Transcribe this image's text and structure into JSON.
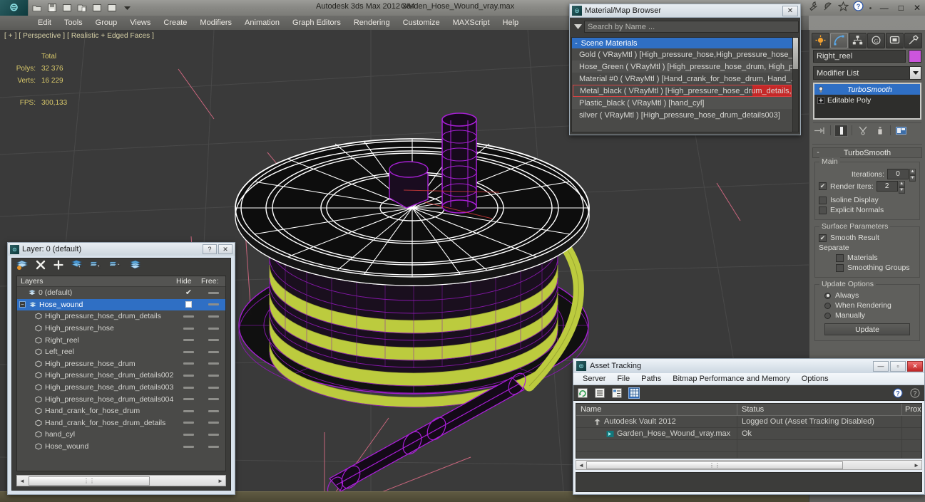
{
  "titlebar": {
    "app_title": "Autodesk 3ds Max  2012 x64",
    "file_title": "Garden_Hose_Wound_vray.max",
    "quick_access": [
      "open-icon",
      "save-icon",
      "undo-icon",
      "redo-icon",
      "page-icon",
      "page2-icon",
      "dropdown-icon"
    ],
    "right_icons": [
      "wrench-icon",
      "satellite-icon",
      "star-icon",
      "help-icon",
      "dot-icon"
    ],
    "window_controls": {
      "minimize": "—",
      "maximize": "□",
      "close": "✕"
    }
  },
  "menubar": {
    "items": [
      "Edit",
      "Tools",
      "Group",
      "Views",
      "Create",
      "Modifiers",
      "Animation",
      "Graph Editors",
      "Rendering",
      "Customize",
      "MAXScript",
      "Help"
    ]
  },
  "viewport": {
    "label": "[ + ] [ Perspective ] [ Realistic + Edged Faces ]",
    "stats": {
      "total_header": "Total",
      "polys_label": "Polys:",
      "polys_value": "32 376",
      "verts_label": "Verts:",
      "verts_value": "16 229",
      "fps_label": "FPS:",
      "fps_value": "300,133"
    },
    "colors": {
      "background": "#3a3a3a",
      "selected_wire": "#ffffff",
      "object_wire": "#aa22cc",
      "hose_green": "#bccb3e",
      "grid": "#4f4f4f"
    }
  },
  "material_browser": {
    "title": "Material/Map Browser",
    "close_label": "✕",
    "search_placeholder": "Search by Name ...",
    "group_label": "Scene Materials",
    "group_marker": "-",
    "items": [
      "Gold ( VRayMtl ) [High_pressure_hose,High_pressure_hose_...",
      "Hose_Green ( VRayMtl ) [High_pressure_hose_drum, High_pr...",
      "Material #0 ( VRayMtl ) [Hand_crank_for_hose_drum, Hand_...",
      "Metal_black ( VRayMtl ) [High_pressure_hose_drum_details,...",
      "Plastic_black  ( VRayMtl )  [hand_cyl]",
      "silver ( VRayMtl ) [High_pressure_hose_drum_details003]"
    ],
    "selected_index": 3,
    "selection_color": "#d84343"
  },
  "command_panel": {
    "tabs": [
      "create-tab",
      "modify-tab",
      "hierarchy-tab",
      "motion-tab",
      "display-tab",
      "utilities-tab"
    ],
    "active_tab_index": 1,
    "object_name": "Right_reel",
    "object_color": "#cc55dd",
    "modifier_list_label": "Modifier List",
    "stack": [
      {
        "label": "TurboSmooth",
        "selected": true,
        "icon": "bulb-icon"
      },
      {
        "label": "Editable Poly",
        "selected": false,
        "icon": "plus-box-icon"
      }
    ],
    "stack_tools": [
      "pin-stack-icon",
      "show-end-result-icon",
      "make-unique-icon",
      "remove-modifier-icon",
      "configure-sets-icon"
    ],
    "rollout": {
      "title": "TurboSmooth",
      "collapse_marker": "-",
      "main_group": "Main",
      "iterations_label": "Iterations:",
      "iterations_value": "0",
      "render_iters_label": "Render Iters:",
      "render_iters_value": "2",
      "render_iters_checked": true,
      "isoline_label": "Isoline Display",
      "isoline_checked": false,
      "explicit_label": "Explicit Normals",
      "explicit_checked": false,
      "surface_group": "Surface Parameters",
      "smooth_result_label": "Smooth Result",
      "smooth_result_checked": true,
      "separate_label": "Separate",
      "materials_label": "Materials",
      "materials_checked": false,
      "smoothing_groups_label": "Smoothing Groups",
      "smoothing_groups_checked": false,
      "update_group": "Update Options",
      "update_options": [
        "Always",
        "When Rendering",
        "Manually"
      ],
      "update_selected": 0,
      "update_button": "Update"
    }
  },
  "layer_window": {
    "title": "Layer: 0 (default)",
    "help_label": "?",
    "close_label": "✕",
    "toolbar": [
      "new-layer-icon",
      "delete-layer-icon",
      "add-selection-icon",
      "select-objects-icon",
      "select-highlighted-icon",
      "highlight-selected-icon",
      "hide-unhide-icon"
    ],
    "columns": [
      "Layers",
      "Hide",
      "Free:"
    ],
    "rows": [
      {
        "name": "0 (default)",
        "type": "layer",
        "indent": 0,
        "selected": false,
        "active_check": true,
        "has_checkbox": false
      },
      {
        "name": "Hose_wound",
        "type": "layer",
        "indent": 0,
        "selected": true,
        "active_check": false,
        "has_checkbox": true,
        "expandable": true
      },
      {
        "name": "High_pressure_hose_drum_details",
        "type": "object",
        "indent": 1,
        "selected": false
      },
      {
        "name": "High_pressure_hose",
        "type": "object",
        "indent": 1,
        "selected": false
      },
      {
        "name": "Right_reel",
        "type": "object",
        "indent": 1,
        "selected": false
      },
      {
        "name": "Left_reel",
        "type": "object",
        "indent": 1,
        "selected": false
      },
      {
        "name": "High_pressure_hose_drum",
        "type": "object",
        "indent": 1,
        "selected": false
      },
      {
        "name": "High_pressure_hose_drum_details002",
        "type": "object",
        "indent": 1,
        "selected": false
      },
      {
        "name": "High_pressure_hose_drum_details003",
        "type": "object",
        "indent": 1,
        "selected": false
      },
      {
        "name": "High_pressure_hose_drum_details004",
        "type": "object",
        "indent": 1,
        "selected": false
      },
      {
        "name": "Hand_crank_for_hose_drum",
        "type": "object",
        "indent": 1,
        "selected": false
      },
      {
        "name": "Hand_crank_for_hose_drum_details",
        "type": "object",
        "indent": 1,
        "selected": false
      },
      {
        "name": "hand_cyl",
        "type": "object",
        "indent": 1,
        "selected": false
      },
      {
        "name": "Hose_wound",
        "type": "object",
        "indent": 1,
        "selected": false
      }
    ],
    "scrollbar": {
      "left_arrow": "◄",
      "right_arrow": "►",
      "grip": "⋮⋮"
    }
  },
  "asset_tracking": {
    "title": "Asset Tracking",
    "window_controls": {
      "minimize": "—",
      "maximize": "▫",
      "close": "✕"
    },
    "menu": [
      "Server",
      "File",
      "Paths",
      "Bitmap Performance and Memory",
      "Options"
    ],
    "toolbar": [
      "refresh-icon",
      "list-view-icon",
      "tree-view-icon",
      "grid-view-icon"
    ],
    "toolbar_active_index": 3,
    "help_icons": [
      "help-blue-icon",
      "help-grey-icon"
    ],
    "columns": [
      "Name",
      "Status",
      "Prox"
    ],
    "rows": [
      {
        "name": "Autodesk Vault 2012",
        "status": "Logged Out (Asset Tracking Disabled)",
        "indent": 0,
        "icon": "vault-icon"
      },
      {
        "name": "Garden_Hose_Wound_vray.max",
        "status": "Ok",
        "indent": 1,
        "icon": "maxfile-icon"
      },
      {
        "name": "",
        "status": "",
        "indent": 0,
        "icon": ""
      }
    ],
    "scrollbar": {
      "left_arrow": "◄",
      "right_arrow": "►",
      "grip": "⋮⋮"
    }
  }
}
